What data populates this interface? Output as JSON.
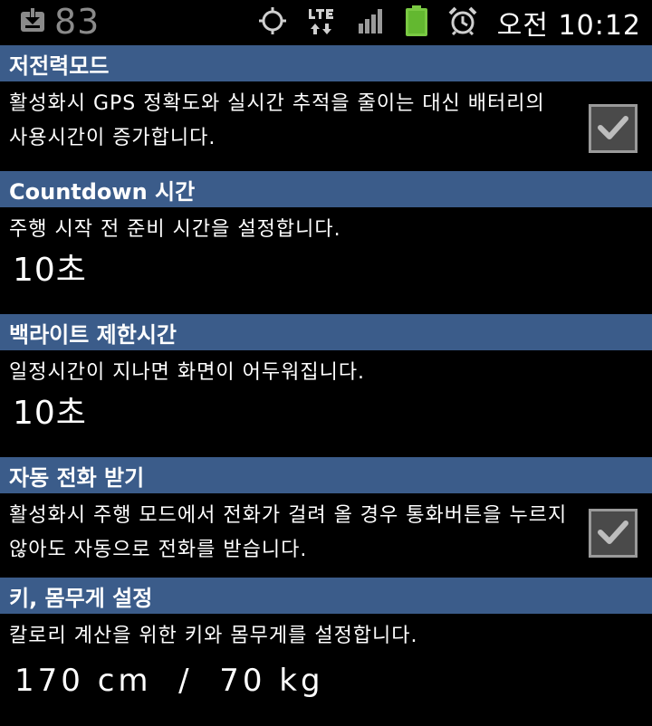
{
  "status_bar": {
    "battery_level": "83",
    "clock": "오전 10:12",
    "icons": [
      "download-icon",
      "gps-icon",
      "lte-icon",
      "signal-icon",
      "battery-icon",
      "alarm-icon"
    ],
    "colors": {
      "battery_fill": "#7ac943",
      "gray": "#8a8a8a"
    }
  },
  "sections": {
    "power_save": {
      "title": "저전력모드",
      "description": "활성화시 GPS 정확도와 실시간 추적을 줄이는 대신 배터리의 사용시간이 증가합니다.",
      "checked": true
    },
    "countdown": {
      "title": "Countdown 시간",
      "description": "주행 시작 전 준비 시간을 설정합니다.",
      "value": "10초"
    },
    "backlight": {
      "title": "백라이트 제한시간",
      "description": "일정시간이 지나면 화면이 어두워집니다.",
      "value": "10초"
    },
    "auto_answer": {
      "title": "자동 전화 받기",
      "description": "활성화시 주행 모드에서 전화가 걸려 올 경우 통화버튼을 누르지 않아도 자동으로 전화를 받습니다.",
      "checked": true
    },
    "body_info": {
      "title": "키, 몸무게 설정",
      "description": "칼로리 계산을 위한 키와 몸무게를 설정합니다.",
      "value": "170 cm  /  70 kg"
    }
  },
  "theme": {
    "header_bg": "#3b5c8a",
    "checkbox_bg": "#4a4a4a",
    "checkbox_border": "#9a9a9a"
  }
}
